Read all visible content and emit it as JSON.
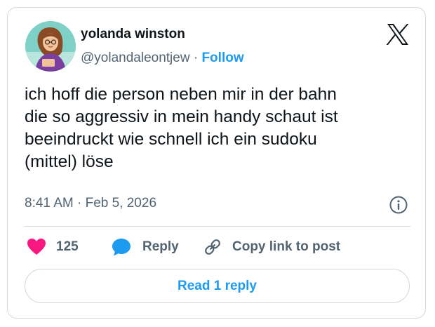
{
  "author": {
    "name": "yolanda winston",
    "handle": "@yolandaleontjew",
    "separator": "·",
    "follow_label": "Follow",
    "avatar_icon": "avatar-photo-icon"
  },
  "brand": {
    "logo_icon": "x-logo-icon"
  },
  "tweet": {
    "lines": [
      "ich hoff die person neben mir in der bahn",
      "die so aggressiv in mein handy schaut ist",
      "beeindruckt wie schnell ich ein sudoku",
      "(mittel) löse"
    ],
    "timestamp": "8:41 AM · Feb 5, 2026"
  },
  "actions": {
    "like_count": "125",
    "reply_label": "Reply",
    "copy_link_label": "Copy link to post",
    "read_reply_label": "Read 1 reply"
  },
  "colors": {
    "accent": "#1d9bf0",
    "like": "#f91880",
    "text": "#0f1419",
    "secondary_text": "#536471",
    "border": "#cfd9de"
  }
}
